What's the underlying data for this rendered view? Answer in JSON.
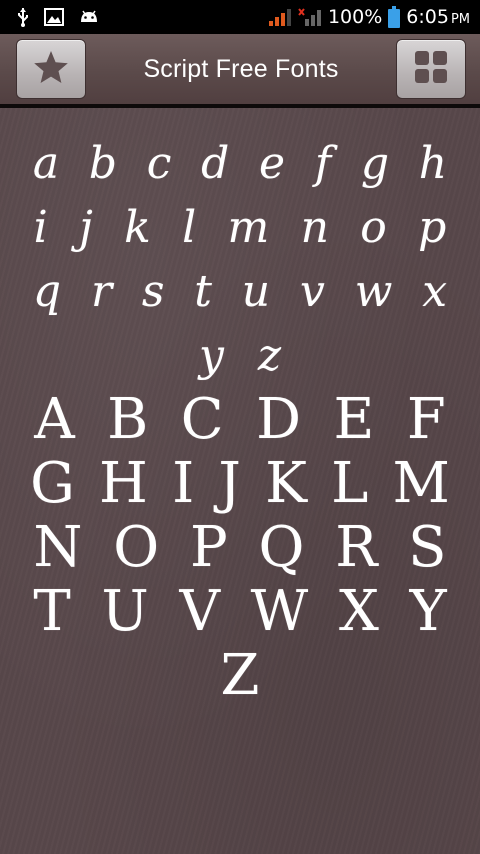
{
  "status_bar": {
    "battery_percent": "100%",
    "time": "6:05",
    "ampm": "PM",
    "icons": [
      "usb-icon",
      "image-icon",
      "android-icon",
      "signal-icon",
      "no-signal-icon",
      "battery-icon"
    ]
  },
  "action_bar": {
    "title": "Script Free Fonts",
    "left_button_icon": "star-icon",
    "right_button_icon": "grid-icon"
  },
  "alphabet": {
    "lowercase_rows": [
      [
        "a",
        "b",
        "c",
        "d",
        "e",
        "f",
        "g",
        "h"
      ],
      [
        "i",
        "j",
        "k",
        "l",
        "m",
        "n",
        "o",
        "p"
      ],
      [
        "q",
        "r",
        "s",
        "t",
        "u",
        "v",
        "w",
        "x"
      ],
      [
        "y",
        "z"
      ]
    ],
    "uppercase_rows": [
      [
        "A",
        "B",
        "C",
        "D",
        "E",
        "F"
      ],
      [
        "G",
        "H",
        "I",
        "J",
        "K",
        "L",
        "M"
      ],
      [
        "N",
        "O",
        "P",
        "Q",
        "R",
        "S"
      ],
      [
        "T",
        "U",
        "V",
        "W",
        "X",
        "Y"
      ],
      [
        "Z"
      ]
    ]
  },
  "colors": {
    "background": "#58474a",
    "action_bar": "#5b4a4a",
    "text": "#ffffff",
    "signal_accent": "#e05a1e"
  }
}
